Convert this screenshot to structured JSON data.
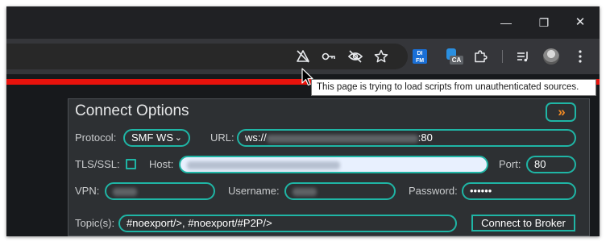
{
  "window": {
    "minimize_glyph": "—",
    "maximize_glyph": "❐",
    "close_glyph": "✕"
  },
  "toolbar": {
    "icons": [
      "insecure-content-icon",
      "password-key-icon",
      "eye-off-icon",
      "bookmark-star-icon",
      "di-fm-extension-icon",
      "ca-extension-icon",
      "extensions-puzzle-icon",
      "media-controls-icon",
      "profile-avatar-icon",
      "menu-dots-icon"
    ],
    "di_fm_text": "DI FM",
    "ca_badge": "CA"
  },
  "tooltip": {
    "text": "This page is trying to load scripts from unauthenticated sources."
  },
  "panel": {
    "title": "Connect Options",
    "collapse_label": "»",
    "protocol_label": "Protocol:",
    "protocol_value": "SMF WS",
    "url_label": "URL:",
    "url_prefix": "ws://",
    "url_suffix": ":80",
    "tls_label": "TLS/SSL:",
    "host_label": "Host:",
    "port_label": "Port:",
    "port_value": "80",
    "vpn_label": "VPN:",
    "username_label": "Username:",
    "password_label": "Password:",
    "password_value": "••••••",
    "topics_label": "Topic(s):",
    "topics_value": "#noexport/>, #noexport/#P2P/>",
    "connect_label": "Connect to Broker"
  },
  "colors": {
    "accent": "#1fb5a5",
    "alert_bar": "#e8120c",
    "collapse_arrow": "#f08a24"
  }
}
